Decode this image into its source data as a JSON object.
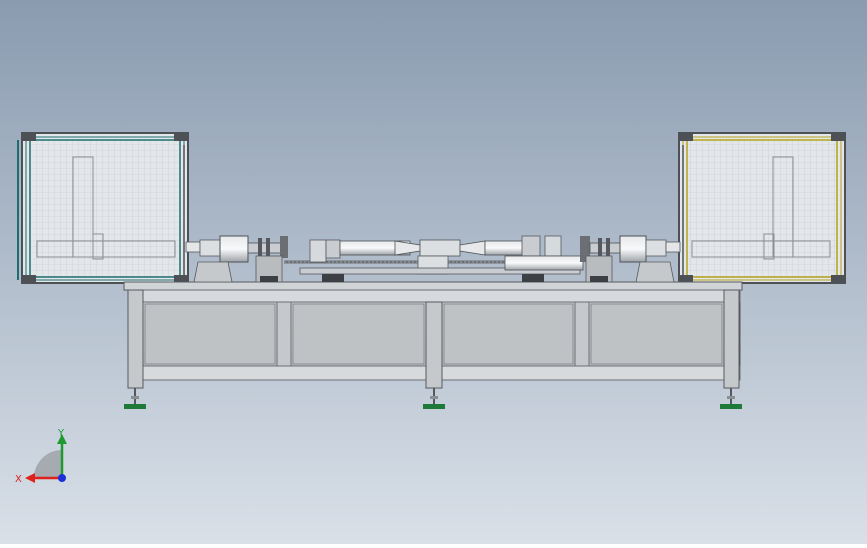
{
  "viewport": {
    "background_top": "#8a9bb0",
    "background_bottom": "#d9e0e8"
  },
  "triad": {
    "x_label": "X",
    "y_label": "Y",
    "x_color": "#e0201b",
    "y_color": "#1f9a2e",
    "z_color": "#1a2fd8"
  },
  "colors": {
    "frame": "#6b6f74",
    "frame_light": "#c8cbce",
    "mesh": "#d7dbe0",
    "left_guard_edge": "#1d6e6e",
    "right_guard_edge": "#b5a21a",
    "foot_pad": "#1f7a3a"
  }
}
